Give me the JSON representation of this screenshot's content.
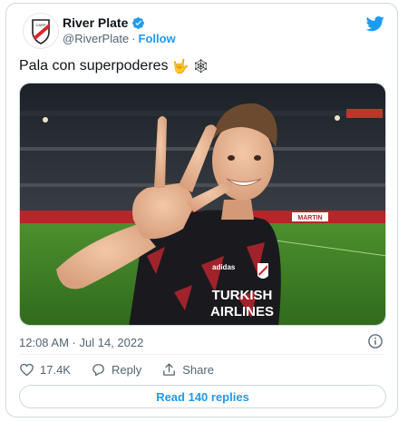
{
  "account": {
    "display_name": "River Plate",
    "handle": "@RiverPlate",
    "separator": "·",
    "follow_label": "Follow"
  },
  "tweet": {
    "text": "Pala con superpoderes",
    "emoji_1": "🤟",
    "emoji_2": "🕸",
    "timestamp": "12:08 AM · Jul 14, 2022"
  },
  "photo": {
    "shirt_text_line1": "TURKISH",
    "shirt_text_line2": "AIRLINES",
    "shirt_brand": "adidas",
    "ad_board_text": "MARTIN"
  },
  "engagement": {
    "likes": "17.4K",
    "reply_label": "Reply",
    "share_label": "Share",
    "read_replies_label": "Read 140 replies"
  },
  "colors": {
    "accent": "#1d9bf0",
    "text": "#0f1419",
    "muted": "#536471",
    "crest_red": "#d9262c"
  }
}
